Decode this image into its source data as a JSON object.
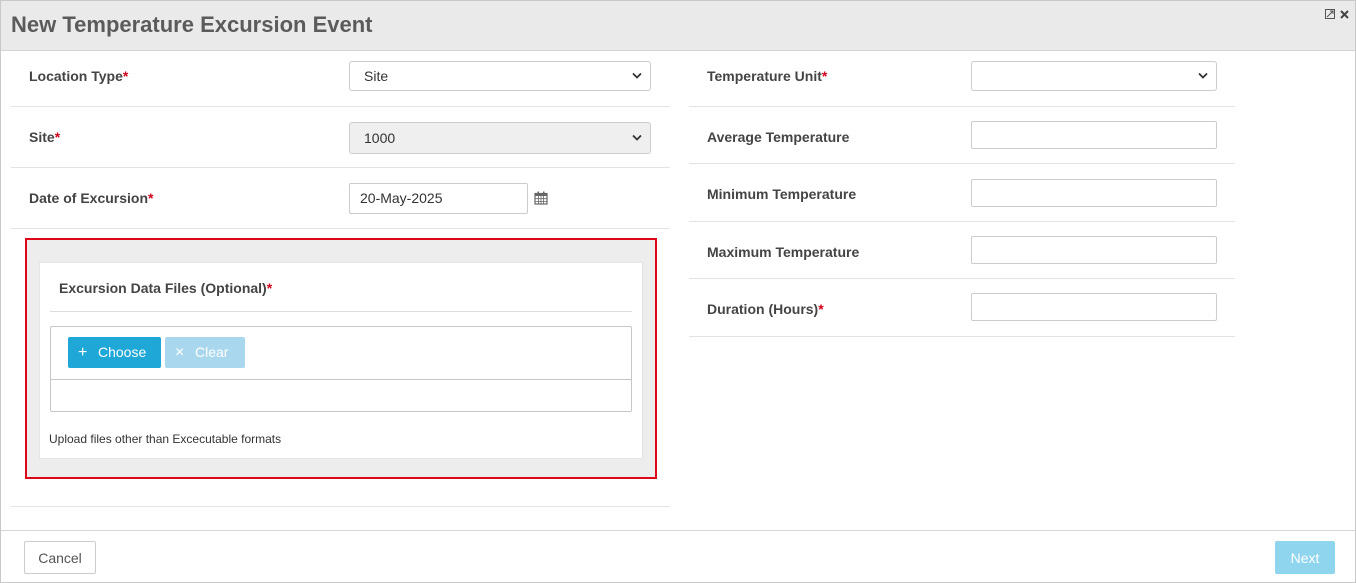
{
  "dialog": {
    "title": "New Temperature Excursion Event",
    "resize_icon": "resize-icon",
    "close_icon": "close-icon"
  },
  "left": {
    "location_type": {
      "label": "Location Type",
      "required": "*",
      "value": "Site"
    },
    "site": {
      "label": "Site",
      "required": "*",
      "value": "1000"
    },
    "date": {
      "label": "Date of Excursion",
      "required": "*",
      "value": "20-May-2025",
      "icon": "calendar-icon"
    }
  },
  "upload": {
    "title": "Excursion Data Files (Optional)",
    "required": "*",
    "choose_label": "Choose",
    "choose_icon": "+",
    "clear_label": "Clear",
    "clear_icon": "×",
    "hint": "Upload files other than Excecutable formats"
  },
  "right": {
    "temperature_unit": {
      "label": "Temperature Unit",
      "required": "*",
      "value": ""
    },
    "average": {
      "label": "Average Temperature",
      "value": ""
    },
    "minimum": {
      "label": "Minimum Temperature",
      "value": ""
    },
    "maximum": {
      "label": "Maximum Temperature",
      "value": ""
    },
    "duration": {
      "label": "Duration (Hours)",
      "required": "*",
      "value": ""
    }
  },
  "footer": {
    "cancel_label": "Cancel",
    "next_label": "Next"
  },
  "colors": {
    "required": "#d0021b",
    "primary": "#1ea7d7",
    "highlight_border": "#e0061a"
  }
}
